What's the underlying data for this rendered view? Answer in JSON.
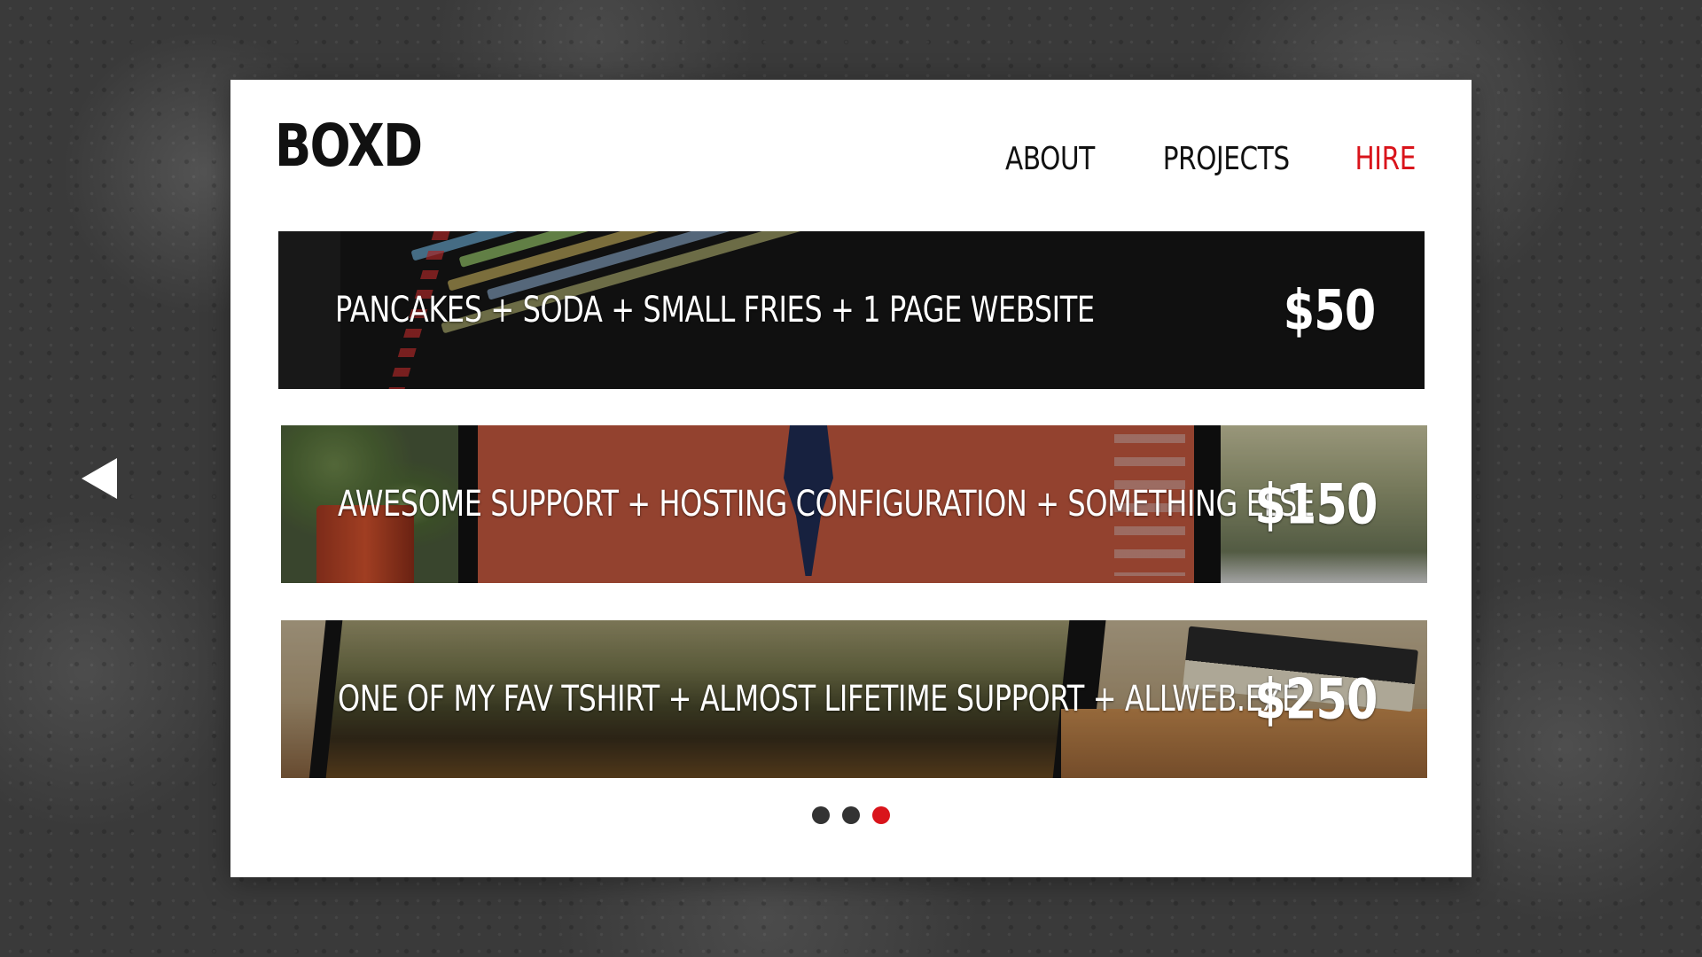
{
  "brand": {
    "logo": "BOXD"
  },
  "nav": {
    "items": [
      {
        "label": "ABOUT",
        "active": false
      },
      {
        "label": "PROJECTS",
        "active": false
      },
      {
        "label": "HIRE",
        "active": true
      }
    ]
  },
  "packages": [
    {
      "description": "PANCAKES + SODA + SMALL FRIES + 1 PAGE WEBSITE",
      "price": "$50"
    },
    {
      "description": "AWESOME SUPPORT + HOSTING CONFIGURATION + SOMETHING ELSE",
      "price": "$150"
    },
    {
      "description": "ONE OF MY FAV TSHIRT + ALMOST LIFETIME SUPPORT + ALLWEB.EXE",
      "price": "$250"
    }
  ],
  "pager": {
    "count": 3,
    "active_index": 2
  },
  "colors": {
    "accent": "#d9141b",
    "card_background": "#ffffff",
    "text_dark": "#111111",
    "pager_inactive": "#333333"
  },
  "icons": {
    "previous": "left-triangle-arrow-icon"
  }
}
